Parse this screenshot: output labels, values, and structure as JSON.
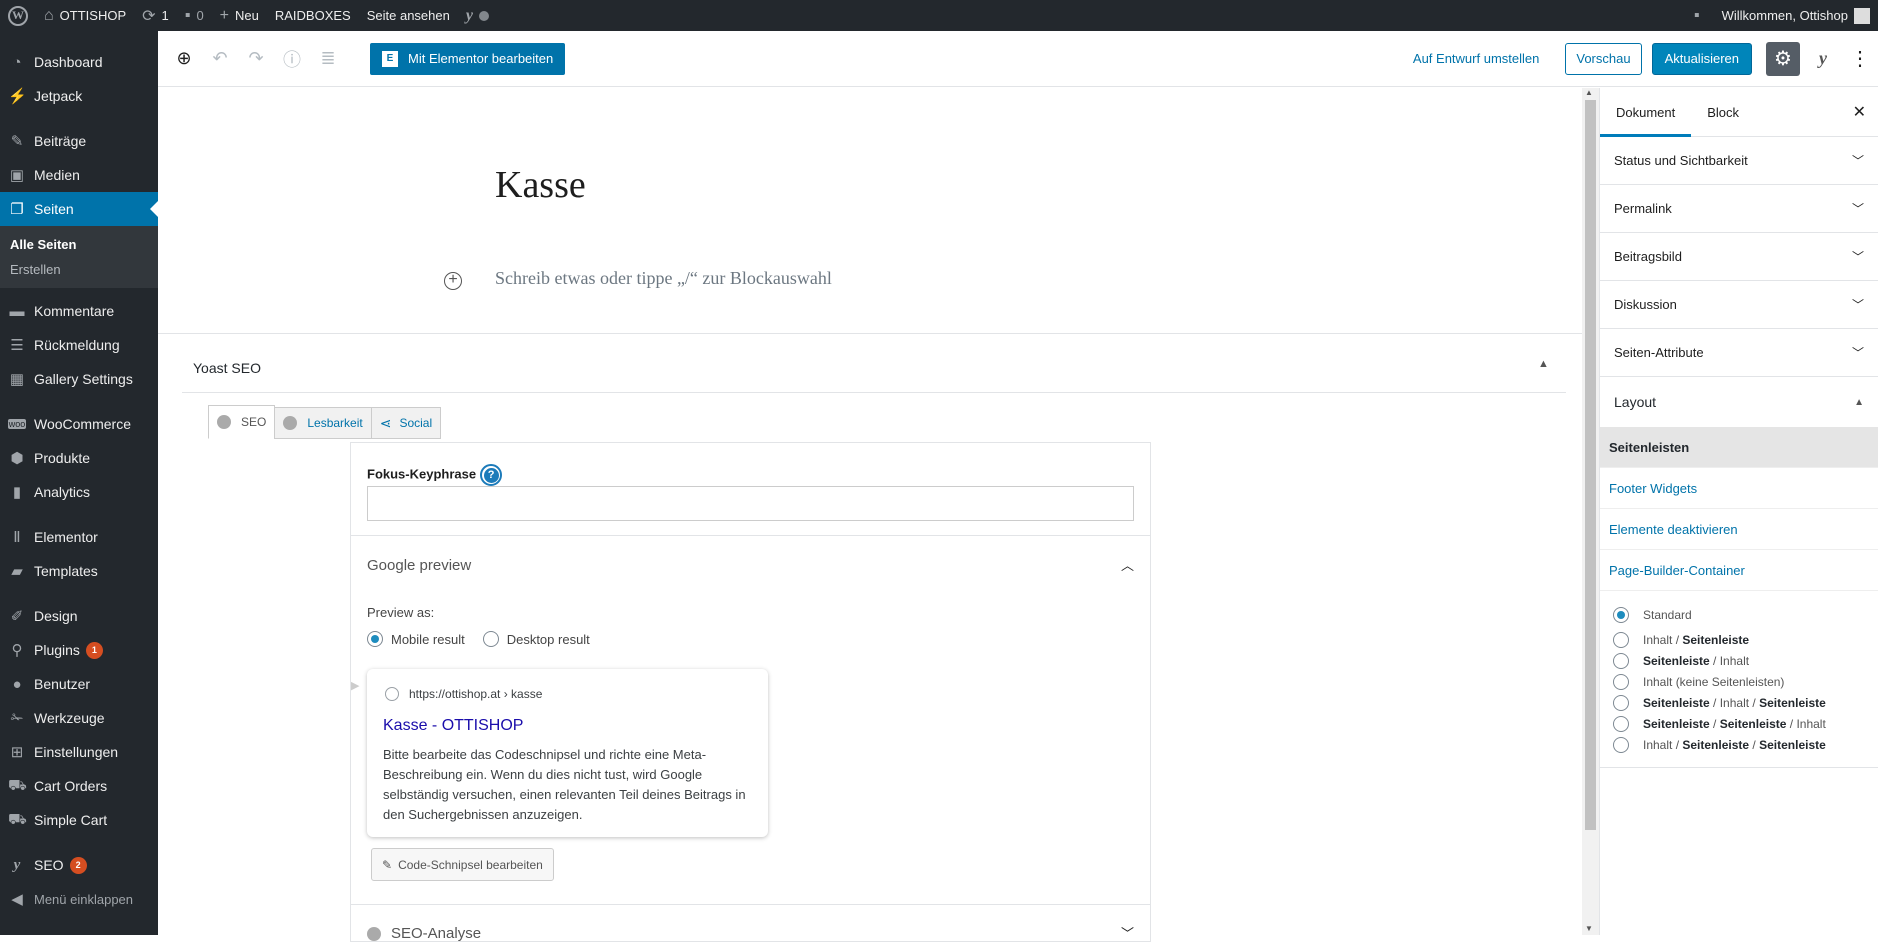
{
  "adminbar": {
    "site_name": "OTTISHOP",
    "updates_count": "1",
    "comments_count": "0",
    "new_label": "Neu",
    "raidboxes_label": "RAIDBOXES",
    "view_site_label": "Seite ansehen",
    "greeting": "Willkommen, Ottishop"
  },
  "sidebar": {
    "items": [
      {
        "label": "Dashboard",
        "icon": "dashboard-icon"
      },
      {
        "label": "Jetpack",
        "icon": "jetpack-icon"
      },
      {
        "label": "Beiträge",
        "icon": "pin-icon"
      },
      {
        "label": "Medien",
        "icon": "media-icon"
      },
      {
        "label": "Seiten",
        "icon": "pages-icon"
      },
      {
        "label": "Kommentare",
        "icon": "comment-icon"
      },
      {
        "label": "Rückmeldung",
        "icon": "feedback-icon"
      },
      {
        "label": "Gallery Settings",
        "icon": "gallery-icon"
      },
      {
        "label": "WooCommerce",
        "icon": "woocommerce-icon"
      },
      {
        "label": "Produkte",
        "icon": "products-icon"
      },
      {
        "label": "Analytics",
        "icon": "analytics-icon"
      },
      {
        "label": "Elementor",
        "icon": "elementor-icon"
      },
      {
        "label": "Templates",
        "icon": "folder-icon"
      },
      {
        "label": "Design",
        "icon": "brush-icon"
      },
      {
        "label": "Plugins",
        "icon": "plugin-icon",
        "badge": "1"
      },
      {
        "label": "Benutzer",
        "icon": "user-icon"
      },
      {
        "label": "Werkzeuge",
        "icon": "wrench-icon"
      },
      {
        "label": "Einstellungen",
        "icon": "settings-icon"
      },
      {
        "label": "Cart Orders",
        "icon": "cart-icon"
      },
      {
        "label": "Simple Cart",
        "icon": "cart-icon"
      },
      {
        "label": "SEO",
        "icon": "yoast-icon",
        "badge": "2"
      },
      {
        "label": "Menü einklappen",
        "icon": "collapse-icon"
      }
    ],
    "submenu": {
      "all_pages": "Alle Seiten",
      "create": "Erstellen"
    }
  },
  "toolbar": {
    "elementor_label": "Mit Elementor bearbeiten",
    "draft_label": "Auf Entwurf umstellen",
    "preview_label": "Vorschau",
    "update_label": "Aktualisieren"
  },
  "editor": {
    "title": "Kasse",
    "placeholder": "Schreib etwas oder tippe „/“ zur Blockauswahl"
  },
  "yoast": {
    "heading": "Yoast SEO",
    "tabs": [
      "SEO",
      "Lesbarkeit",
      "Social"
    ],
    "focus_label": "Fokus-Keyphrase",
    "focus_value": "",
    "help": "?",
    "google_preview": "Google preview",
    "preview_as": "Preview as:",
    "mobile_result": "Mobile result",
    "desktop_result": "Desktop result",
    "serp_url": "https://ottishop.at › kasse",
    "serp_title": "Kasse - OTTISHOP",
    "serp_desc": "Bitte bearbeite das Codeschnipsel und richte eine Meta-Beschreibung ein. Wenn du dies nicht tust, wird Google selbständig versuchen, einen relevanten Teil deines Beitrags in den Suchergebnissen anzuzeigen.",
    "edit_snippet": "Code-Schnipsel bearbeiten",
    "seo_analysis": "SEO-Analyse"
  },
  "panel": {
    "tab_document": "Dokument",
    "tab_block": "Block",
    "sections": [
      "Status und Sichtbarkeit",
      "Permalink",
      "Beitragsbild",
      "Diskussion",
      "Seiten-Attribute"
    ],
    "layout": {
      "heading": "Layout",
      "tabs": [
        "Seitenleisten",
        "Footer Widgets",
        "Elemente deaktivieren",
        "Page-Builder-Container"
      ],
      "options": {
        "standard": "Standard",
        "o1a": "Inhalt",
        "o1b": "Seitenleiste",
        "o2a": "Seitenleiste",
        "o2b": "Inhalt",
        "o3": "Inhalt (keine Seitenleisten)",
        "o4a": "Seitenleiste",
        "o4b": "Inhalt",
        "o4c": "Seitenleiste",
        "o5a": "Seitenleiste",
        "o5b": "Seitenleiste",
        "o5c": "Inhalt",
        "o6a": "Inhalt",
        "o6b": "Seitenleiste",
        "o6c": "Seitenleiste"
      }
    }
  },
  "colors": {
    "accent": "#0073aa",
    "adminbar": "#23282d",
    "badge": "#d54e21"
  }
}
